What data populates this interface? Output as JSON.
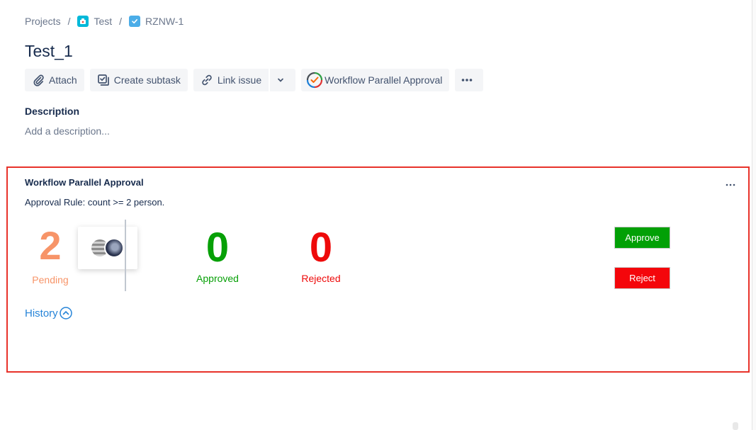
{
  "breadcrumb": {
    "projects": "Projects",
    "separator": "/",
    "project": "Test",
    "issue_key": "RZNW-1"
  },
  "issue": {
    "title": "Test_1"
  },
  "toolbar": {
    "attach": "Attach",
    "create_subtask": "Create subtask",
    "link_issue": "Link issue",
    "workflow_parallel_approval": "Workflow Parallel Approval",
    "more": "•••"
  },
  "description": {
    "label": "Description",
    "placeholder": "Add a description..."
  },
  "approval_panel": {
    "title": "Workflow Parallel Approval",
    "more": "•••",
    "rule": "Approval Rule: count >= 2 person.",
    "pending": {
      "count": "2",
      "label": "Pending"
    },
    "approved": {
      "count": "0",
      "label": "Approved"
    },
    "rejected": {
      "count": "0",
      "label": "Rejected"
    },
    "approve_button": "Approve",
    "reject_button": "Reject",
    "history": "History"
  },
  "colors": {
    "pending": "#f79468",
    "approved": "#07a007",
    "rejected": "#ee0a0a",
    "approve_bg": "#02a006",
    "reject_bg": "#f4060b",
    "link": "#2684d8",
    "panel_border": "#e8322a"
  },
  "icons": {
    "attach": "paperclip-icon",
    "subtask": "subtask-icon",
    "link": "link-icon",
    "dropdown": "chevron-down-icon",
    "workflow": "workflow-approval-icon",
    "history": "chevron-up-circle-icon"
  }
}
